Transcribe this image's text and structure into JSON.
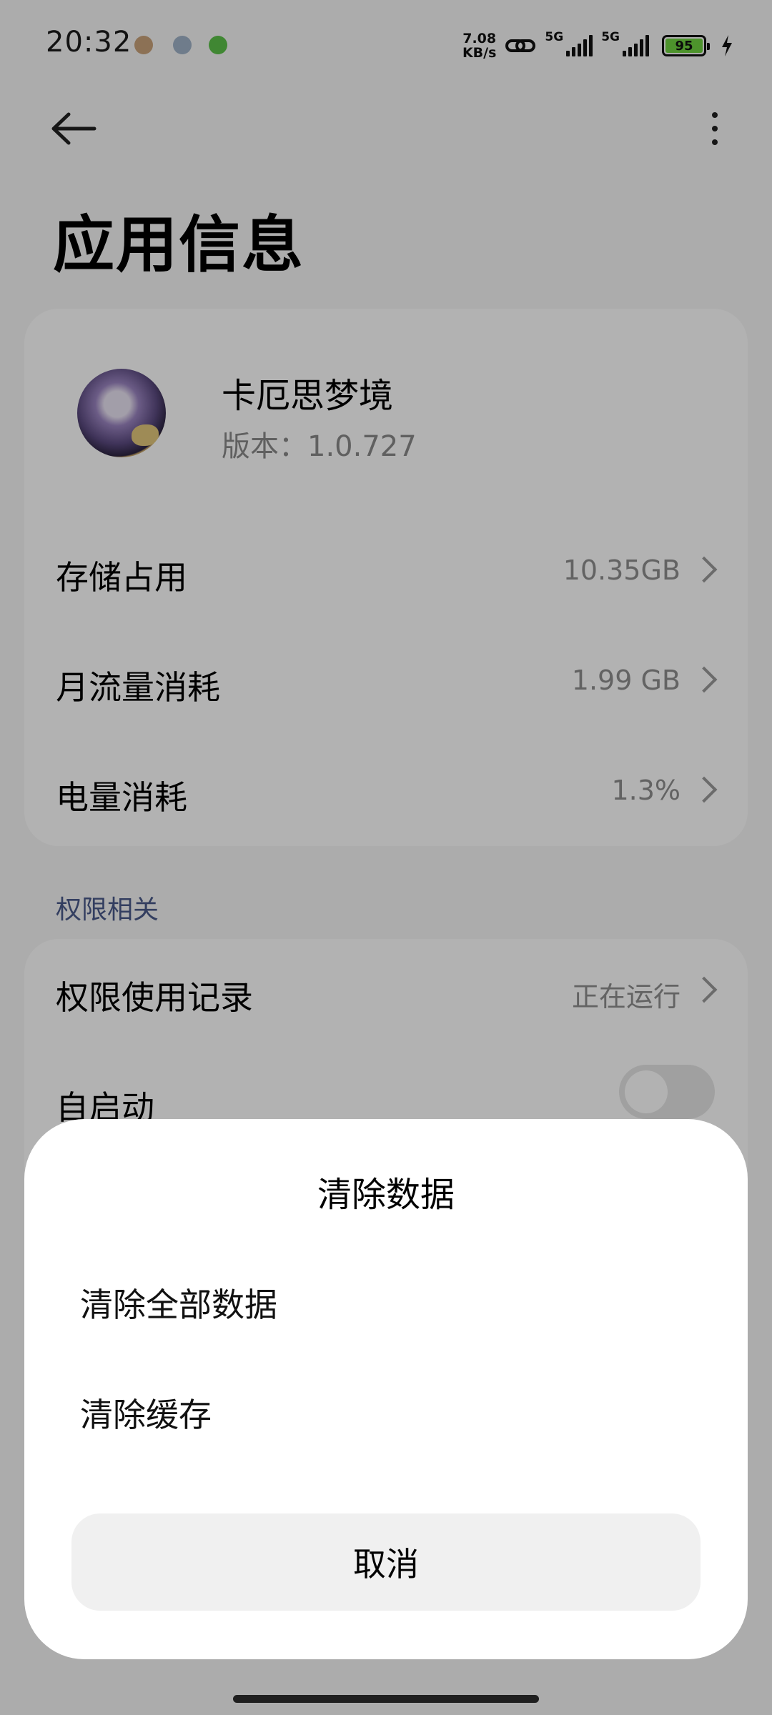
{
  "status_bar": {
    "time": "20:32",
    "notification_icons": [
      "app-notification-icon",
      "vpn-notification-icon",
      "download-notification-icon"
    ],
    "net_speed_value": "7.08",
    "net_speed_unit": "KB/s",
    "network_label_1": "5G",
    "network_label_2": "5G",
    "battery_level": "95",
    "icons": [
      "link-icon",
      "signal-icon",
      "battery-icon",
      "charging-icon"
    ]
  },
  "header": {
    "title": "应用信息",
    "back_icon": "back-arrow-icon",
    "more_icon": "more-vertical-icon"
  },
  "app": {
    "name": "卡厄思梦境",
    "version": "版本：1.0.727"
  },
  "info_rows": [
    {
      "label": "存储占用",
      "value": "10.35GB"
    },
    {
      "label": "月流量消耗",
      "value": "1.99 GB"
    },
    {
      "label": "电量消耗",
      "value": "1.3%"
    }
  ],
  "permissions": {
    "section_title": "权限相关",
    "usage_record_label": "权限使用记录",
    "usage_record_value": "正在运行",
    "autostart_label": "自启动",
    "autostart_enabled": false
  },
  "dialog": {
    "title": "清除数据",
    "options": [
      "清除全部数据",
      "清除缓存"
    ],
    "cancel_label": "取消"
  },
  "colors": {
    "background": "#f7f7f7",
    "card": "#ffffff",
    "secondary_text": "#8f8f8f",
    "section_header": "#4a5a8a",
    "battery_fill": "#6fd33f",
    "overlay": "rgba(0,0,0,0.3)"
  }
}
